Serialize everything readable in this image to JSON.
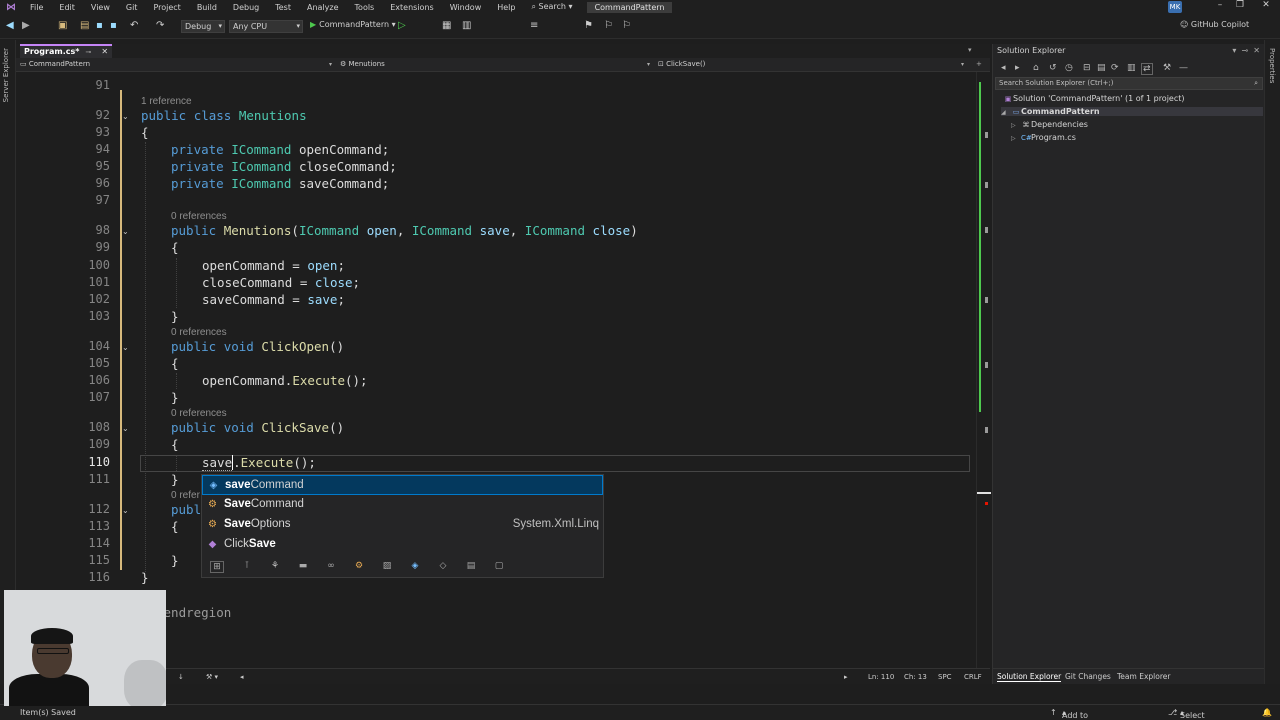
{
  "menu": {
    "items": [
      "File",
      "Edit",
      "View",
      "Git",
      "Project",
      "Build",
      "Debug",
      "Test",
      "Analyze",
      "Tools",
      "Extensions",
      "Window",
      "Help"
    ],
    "search": "Search",
    "project": "CommandPattern",
    "user_initials": "MK"
  },
  "toolbar": {
    "config": "Debug",
    "platform": "Any CPU",
    "run_target": "CommandPattern",
    "copilot": "GitHub Copilot"
  },
  "left_strip": "Server Explorer",
  "right_strip": "Properties",
  "tab": {
    "label": "Program.cs*"
  },
  "navbar": {
    "project": "CommandPattern",
    "class": "Menutions",
    "member": "ClickSave()"
  },
  "editor": {
    "line_numbers": [
      "91",
      "92",
      "93",
      "94",
      "95",
      "96",
      "97",
      "98",
      "99",
      "100",
      "101",
      "102",
      "103",
      "104",
      "105",
      "106",
      "107",
      "108",
      "109",
      "110",
      "111",
      "112",
      "113",
      "114",
      "115",
      "116"
    ],
    "lens": {
      "class_refs": "1 reference",
      "ctor_refs": "0 references",
      "open_refs": "0 references",
      "save_refs": "0 references",
      "next_refs": "0 refer"
    },
    "lines": {
      "l92": "public class Menutions",
      "l93": "{",
      "l94": "private ICommand openCommand;",
      "l95": "private ICommand closeCommand;",
      "l96": "private ICommand saveCommand;",
      "l98": "public Menutions(ICommand open, ICommand save, ICommand close)",
      "l99": "{",
      "l100": "openCommand = open;",
      "l101": "closeCommand = close;",
      "l102": "saveCommand = save;",
      "l103": "}",
      "l104": "public void ClickOpen()",
      "l105": "{",
      "l106": "openCommand.Execute();",
      "l107": "}",
      "l108": "public void ClickSave()",
      "l109": "{",
      "l110": "save.Execute();",
      "l111": "}",
      "l112": "publ",
      "l113": "{",
      "l115": "}",
      "l116": "}",
      "endregion": "#endregion"
    }
  },
  "completion": {
    "items": [
      {
        "match": "save",
        "rest": "Command",
        "detail": "",
        "icon": "field-icon",
        "selected": true
      },
      {
        "match": "Save",
        "rest": "Command",
        "detail": "",
        "icon": "class-icon",
        "selected": false
      },
      {
        "match": "Save",
        "rest": "Options",
        "detail": "System.Xml.Linq",
        "icon": "class-icon",
        "selected": false
      },
      {
        "prefix": "Click",
        "match": "Save",
        "rest": "",
        "detail": "",
        "icon": "method-icon",
        "selected": false
      }
    ]
  },
  "editor_status": {
    "ln": "Ln: 110",
    "ch": "Ch: 13",
    "spc": "SPC",
    "crlf": "CRLF"
  },
  "solution_explorer": {
    "title": "Solution Explorer",
    "search_placeholder": "Search Solution Explorer (Ctrl+;)",
    "solution": "Solution 'CommandPattern' (1 of 1 project)",
    "project": "CommandPattern",
    "dependencies": "Dependencies",
    "file": "Program.cs",
    "tabs": [
      "Solution Explorer",
      "Git Changes",
      "Team Explorer"
    ]
  },
  "statusbar": {
    "left": "Item(s) Saved",
    "source_control": "Add to Source Control",
    "repository": "Select Repository"
  },
  "colors": {
    "keyword": "#569cd6",
    "type": "#4ec9b0",
    "method": "#dcdcaa",
    "parameter": "#9cdcfe",
    "accent": "#007acc"
  }
}
